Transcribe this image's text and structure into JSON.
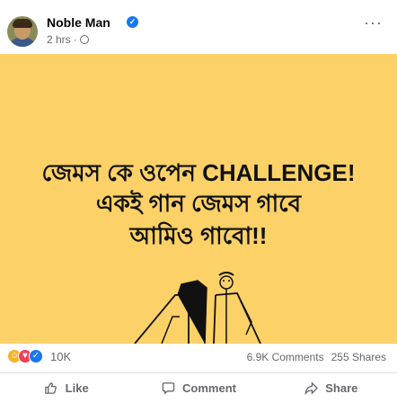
{
  "post": {
    "author": "Noble Man",
    "time": "2 hrs",
    "separator": "·"
  },
  "image_text": {
    "line1": "জেমস কে ওপেন CHALLENGE!",
    "line2": "একই গান জেমস গাবে",
    "line3": "আমিও গাবো!!"
  },
  "stats": {
    "reaction_count": "10K",
    "comments": "6.9K Comments",
    "shares": "255 Shares"
  },
  "actions": {
    "like": "Like",
    "comment": "Comment",
    "share": "Share"
  },
  "colors": {
    "image_background": "#fbd168",
    "accent": "#1877f2",
    "secondary_text": "#65676b"
  },
  "icons": [
    "verified-icon",
    "globe-icon",
    "more-options-icon",
    "haha-reaction-icon",
    "love-reaction-icon",
    "like-reaction-icon",
    "like-thumb-icon",
    "comment-bubble-icon",
    "share-arrow-icon"
  ]
}
